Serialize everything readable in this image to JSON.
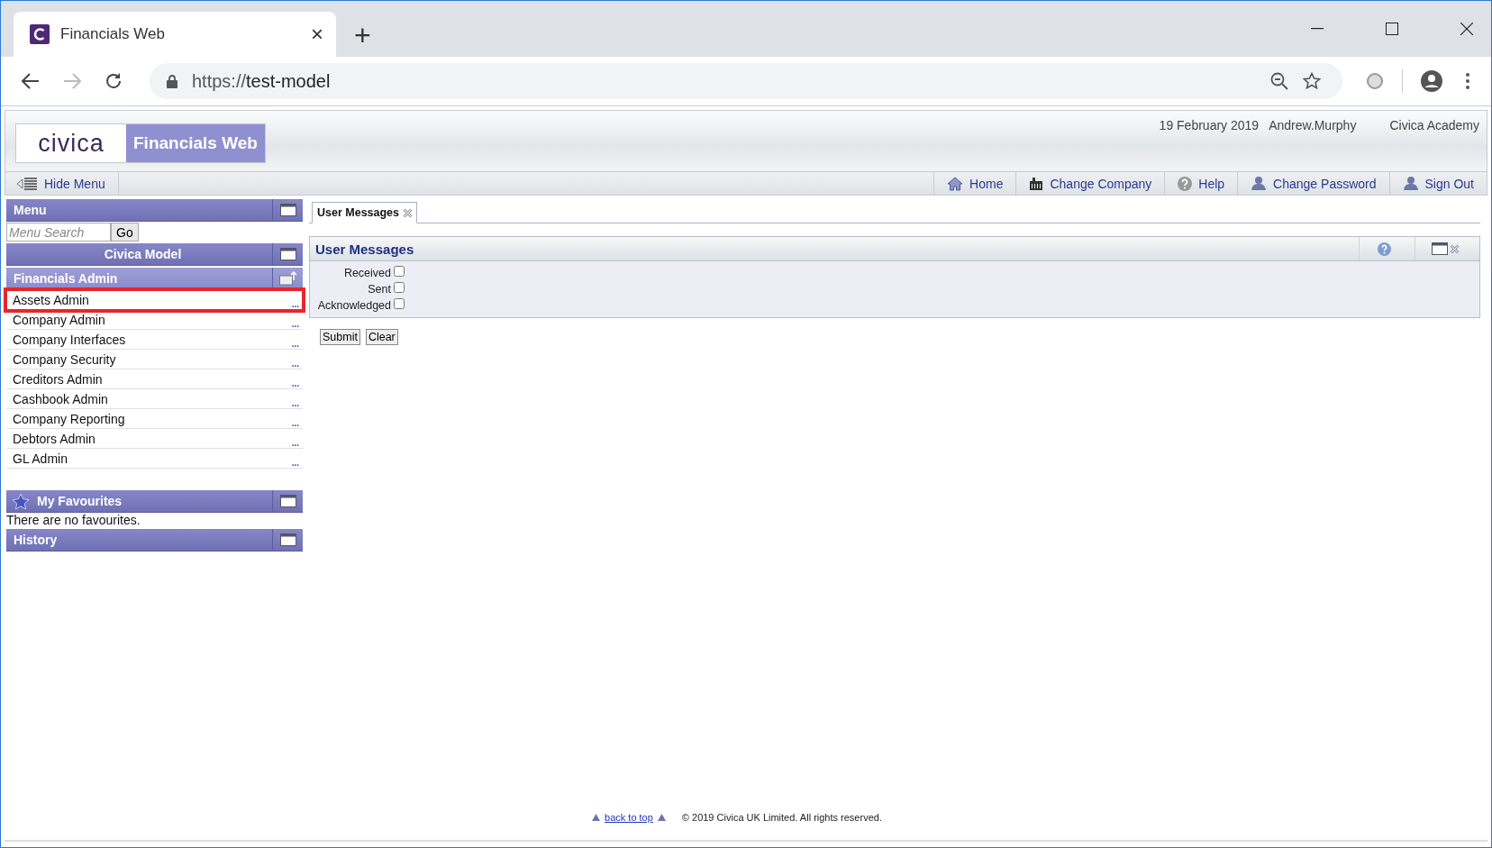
{
  "browser": {
    "tab": {
      "title": "Financials Web",
      "close": "×",
      "selected": true
    },
    "new_tab": "+",
    "url": {
      "scheme": "https://",
      "host": "test-model"
    }
  },
  "app": {
    "logo": "civica",
    "product": "Financials Web",
    "date": "19 February 2019",
    "user": "Andrew.Murphy",
    "company": "Civica Academy"
  },
  "toolbar": {
    "hide_menu": "Hide Menu",
    "links": [
      {
        "kind": "home",
        "label": "Home"
      },
      {
        "kind": "company",
        "label": "Change Company"
      },
      {
        "kind": "help",
        "label": "Help"
      },
      {
        "kind": "user",
        "label": "Change Password"
      },
      {
        "kind": "user",
        "label": "Sign Out"
      }
    ]
  },
  "sidebar": {
    "menu": {
      "title": "Menu",
      "search_placeholder": "Menu Search",
      "go": "Go"
    },
    "model": "Civica Model",
    "section": {
      "title": "Financials Admin",
      "items": [
        {
          "label": "Assets Admin",
          "more": "...",
          "highlighted": true
        },
        {
          "label": "Company Admin",
          "more": "...",
          "highlighted": false
        },
        {
          "label": "Company Interfaces",
          "more": "...",
          "highlighted": false
        },
        {
          "label": "Company Security",
          "more": "...",
          "highlighted": false
        },
        {
          "label": "Creditors Admin",
          "more": "...",
          "highlighted": false
        },
        {
          "label": "Cashbook Admin",
          "more": "...",
          "highlighted": false
        },
        {
          "label": "Company Reporting",
          "more": "...",
          "highlighted": false
        },
        {
          "label": "Debtors Admin",
          "more": "...",
          "highlighted": false
        },
        {
          "label": "GL Admin",
          "more": "...",
          "highlighted": false
        }
      ]
    },
    "favourites": {
      "title": "My Favourites",
      "empty": "There are no favourites."
    },
    "history": {
      "title": "History"
    }
  },
  "content": {
    "tabs": [
      {
        "label": "User Messages",
        "selected": true
      }
    ],
    "panel": {
      "title": "User Messages",
      "filters": [
        {
          "label": "Received",
          "checked": false
        },
        {
          "label": "Sent",
          "checked": false
        },
        {
          "label": "Acknowledged",
          "checked": false
        }
      ]
    },
    "buttons": [
      "Submit",
      "Clear"
    ]
  },
  "footer": {
    "back_to_top": "back to top",
    "copyright": "© 2019 Civica UK Limited. All rights reserved."
  }
}
